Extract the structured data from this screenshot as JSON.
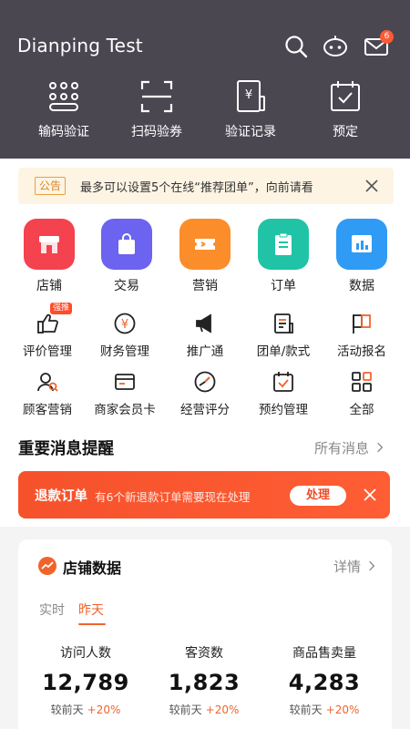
{
  "header": {
    "title": "Dianping Test",
    "mail_badge": "6",
    "icons": [
      "search-icon",
      "assistant-robot-icon",
      "mail-icon"
    ],
    "quick_actions": [
      {
        "label": "输码验证",
        "icon": "keypad-icon"
      },
      {
        "label": "扫码验券",
        "icon": "scan-icon"
      },
      {
        "label": "验证记录",
        "icon": "receipt-icon"
      },
      {
        "label": "预定",
        "icon": "calendar-check-icon"
      }
    ]
  },
  "notice": {
    "tag": "公告",
    "text": "最多可以设置5个在线“推荐团单”，向前请看"
  },
  "categories": [
    {
      "label": "店铺",
      "icon": "shop-icon",
      "color": "#f4424f"
    },
    {
      "label": "交易",
      "icon": "bag-icon",
      "color": "#6c63f0"
    },
    {
      "label": "营销",
      "icon": "ticket-icon",
      "color": "#fb8d2a"
    },
    {
      "label": "订单",
      "icon": "clipboard-icon",
      "color": "#20c3a6"
    },
    {
      "label": "数据",
      "icon": "chart-icon",
      "color": "#2f9bf4"
    }
  ],
  "functions": [
    {
      "label": "评价管理",
      "icon": "thumb-up-icon",
      "badge": "强推"
    },
    {
      "label": "财务管理",
      "icon": "yuan-coin-icon"
    },
    {
      "label": "推广通",
      "icon": "megaphone-icon"
    },
    {
      "label": "团单/款式",
      "icon": "document-icon"
    },
    {
      "label": "活动报名",
      "icon": "flag-icon"
    },
    {
      "label": "顾客营销",
      "icon": "customer-icon"
    },
    {
      "label": "商家会员卡",
      "icon": "card-icon"
    },
    {
      "label": "经营评分",
      "icon": "gauge-icon"
    },
    {
      "label": "预约管理",
      "icon": "calendar-icon"
    },
    {
      "label": "全部",
      "icon": "grid-icon"
    }
  ],
  "messages": {
    "title": "重要消息提醒",
    "link": "所有消息",
    "refund": {
      "title": "退款订单",
      "desc": "有6个新退款订单需要现在处理",
      "button": "处理"
    }
  },
  "store_data": {
    "title": "店铺数据",
    "link": "详情",
    "tabs": [
      "实时",
      "昨天"
    ],
    "active_tab": "昨天",
    "stats": [
      {
        "label": "访问人数",
        "value": "12,789",
        "compare": "较前天",
        "change": "+20%"
      },
      {
        "label": "客资数",
        "value": "1,823",
        "compare": "较前天",
        "change": "+20%"
      },
      {
        "label": "商品售卖量",
        "value": "4,283",
        "compare": "较前天",
        "change": "+20%"
      }
    ]
  },
  "colors": {
    "header_bg": "#4a4751",
    "accent": "#f0642c",
    "notice_bg": "#fdf4e4"
  }
}
